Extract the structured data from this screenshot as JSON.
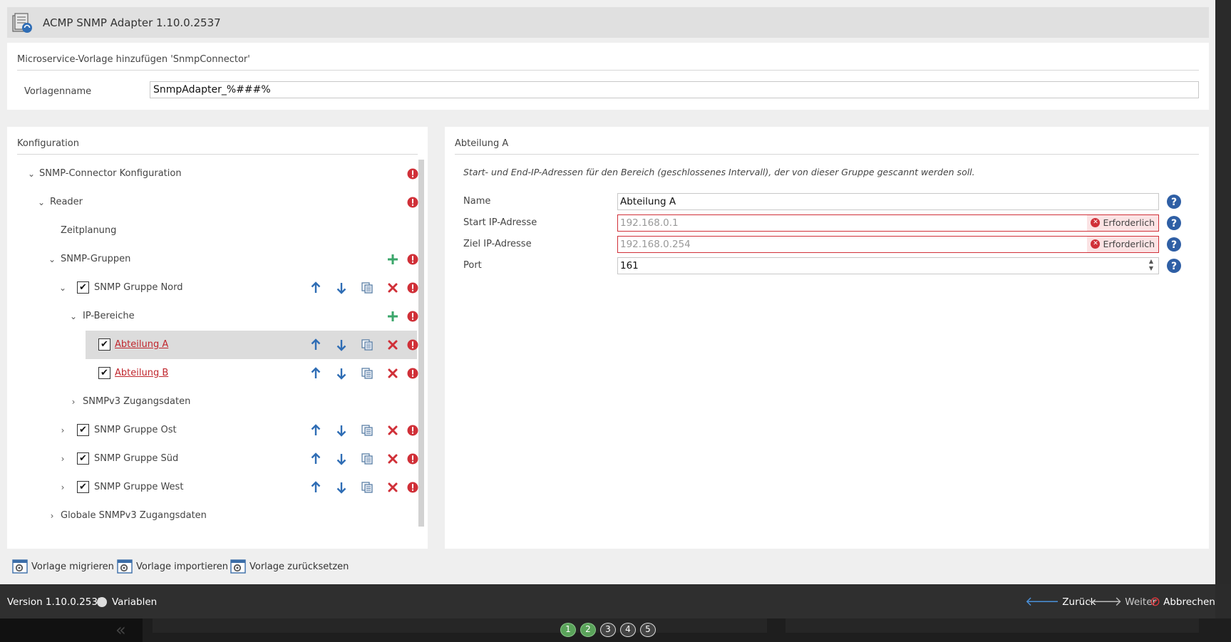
{
  "app": {
    "title": "ACMP SNMP Adapter 1.10.0.2537"
  },
  "template": {
    "heading": "Microservice-Vorlage hinzufügen 'SnmpConnector'",
    "name_label": "Vorlagenname",
    "name_value": "SnmpAdapter_%###%"
  },
  "config": {
    "heading": "Konfiguration",
    "tree": [
      {
        "label": "SNMP-Connector Konfiguration",
        "chevron": "⌄"
      },
      {
        "label": "Reader",
        "chevron": "⌄"
      },
      {
        "label": "Zeitplanung",
        "chevron": ""
      },
      {
        "label": "SNMP-Gruppen",
        "chevron": "⌄"
      },
      {
        "label": "SNMP Gruppe Nord",
        "chevron": "⌄",
        "checked": "✔"
      },
      {
        "label": "IP-Bereiche",
        "chevron": "⌄"
      },
      {
        "label": "Abteilung A",
        "chevron": "",
        "checked": "✔"
      },
      {
        "label": "Abteilung B",
        "chevron": "",
        "checked": "✔"
      },
      {
        "label": "SNMPv3 Zugangsdaten",
        "chevron": "›"
      },
      {
        "label": "SNMP Gruppe Ost",
        "chevron": "›",
        "checked": "✔"
      },
      {
        "label": "SNMP Gruppe Süd",
        "chevron": "›",
        "checked": "✔"
      },
      {
        "label": "SNMP Gruppe West",
        "chevron": "›",
        "checked": "✔"
      },
      {
        "label": "Globale SNMPv3 Zugangsdaten",
        "chevron": "›"
      }
    ]
  },
  "detail": {
    "heading": "Abteilung A",
    "description": "Start- und End-IP-Adressen für den Bereich (geschlossenes Intervall), der von dieser Gruppe gescannt werden soll.",
    "required_text": "Erforderlich",
    "fields": [
      {
        "label": "Name",
        "value": "Abteilung A"
      },
      {
        "label": "Start IP-Adresse",
        "value": "192.168.0.1"
      },
      {
        "label": "Ziel IP-Adresse",
        "value": "192.168.0.254"
      },
      {
        "label": "Port",
        "value": "161"
      }
    ]
  },
  "actions": {
    "migrate": "Vorlage migrieren",
    "import": "Vorlage importieren",
    "reset": "Vorlage zurücksetzen"
  },
  "status": {
    "version": "Version 1.10.0.2537",
    "variables": "Variablen",
    "back": "Zurück",
    "next": "Weiter",
    "cancel": "Abbrechen"
  },
  "background": {
    "steps": [
      "1",
      "2",
      "3",
      "4",
      "5"
    ],
    "chevron": "«"
  },
  "colors": {
    "accent_blue": "#2f6db5",
    "error_red": "#d03038",
    "add_green": "#3aa66a"
  }
}
